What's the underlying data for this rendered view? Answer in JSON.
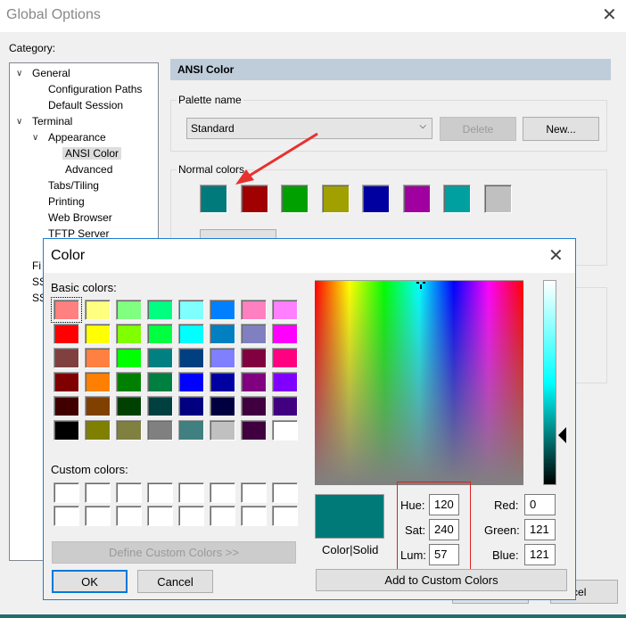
{
  "window": {
    "title": "Global Options",
    "close_icon": "close-icon"
  },
  "category_label": "Category:",
  "tree": [
    {
      "label": "General",
      "level": 0,
      "expanded": true
    },
    {
      "label": "Configuration Paths",
      "level": 1
    },
    {
      "label": "Default Session",
      "level": 1
    },
    {
      "label": "Terminal",
      "level": 0,
      "expanded": true
    },
    {
      "label": "Appearance",
      "level": 1,
      "expanded": true
    },
    {
      "label": "ANSI Color",
      "level": 2,
      "selected": true
    },
    {
      "label": "Advanced",
      "level": 2
    },
    {
      "label": "Tabs/Tiling",
      "level": 1
    },
    {
      "label": "Printing",
      "level": 1
    },
    {
      "label": "Web Browser",
      "level": 1
    },
    {
      "label": "TFTP Server",
      "level": 1
    }
  ],
  "tree_partial": [
    "Fi",
    "SS",
    "SS"
  ],
  "panel": {
    "header": "ANSI Color",
    "palette_label": "Palette name",
    "palette_value": "Standard",
    "delete_label": "Delete",
    "new_label": "New...",
    "normal_colors_label": "Normal colors",
    "normal_colors": [
      "#007a7a",
      "#a00000",
      "#00a000",
      "#a0a000",
      "#0000a0",
      "#a000a0",
      "#00a0a0",
      "#c0c0c0"
    ],
    "bg_cancel_label": "Cancel"
  },
  "color_dialog": {
    "title": "Color",
    "basic_label": "Basic colors:",
    "basic_colors": [
      "#FF8080",
      "#FFFF80",
      "#80FF80",
      "#00FF80",
      "#80FFFF",
      "#0080FF",
      "#FF80C0",
      "#FF80FF",
      "#FF0000",
      "#FFFF00",
      "#80FF00",
      "#00FF40",
      "#00FFFF",
      "#0080C0",
      "#8080C0",
      "#FF00FF",
      "#804040",
      "#FF8040",
      "#00FF00",
      "#008080",
      "#004080",
      "#8080FF",
      "#800040",
      "#FF0080",
      "#800000",
      "#FF8000",
      "#008000",
      "#008040",
      "#0000FF",
      "#0000A0",
      "#800080",
      "#8000FF",
      "#400000",
      "#804000",
      "#004000",
      "#004040",
      "#000080",
      "#000040",
      "#400040",
      "#400080",
      "#000000",
      "#808000",
      "#808040",
      "#808080",
      "#408080",
      "#C0C0C0",
      "#400040",
      "#FFFFFF"
    ],
    "custom_label": "Custom colors:",
    "define_label": "Define Custom Colors >>",
    "ok_label": "OK",
    "cancel_label": "Cancel",
    "preview_color": "#007979",
    "preview_label": "Color|Solid",
    "hue_label": "Hue:",
    "hue": "120",
    "sat_label": "Sat:",
    "sat": "240",
    "lum_label": "Lum:",
    "lum": "57",
    "red_label": "Red:",
    "red": "0",
    "green_label": "Green:",
    "green": "121",
    "blue_label": "Blue:",
    "blue": "121",
    "add_label": "Add to Custom Colors",
    "highlight_color": "#e02020"
  }
}
